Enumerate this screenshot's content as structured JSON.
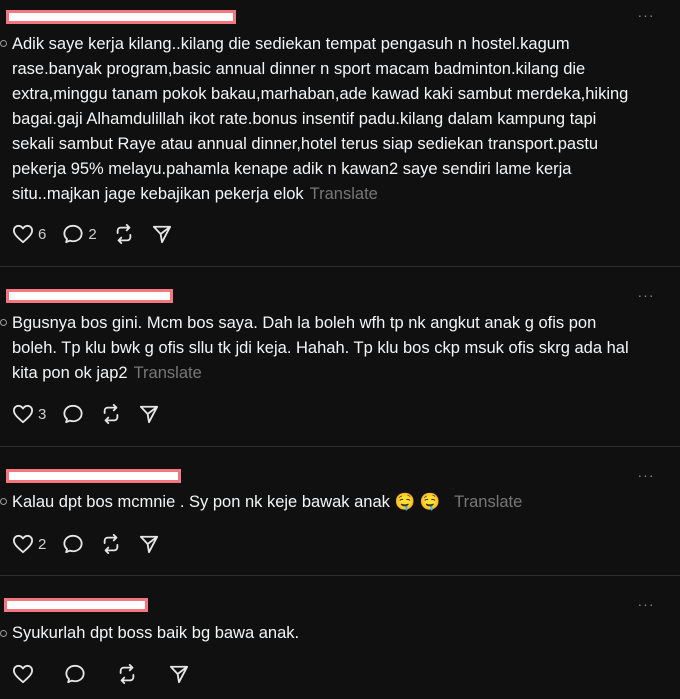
{
  "colors": {
    "background": "#101010",
    "text": "#f3f5f7",
    "muted": "#777777",
    "redaction_border": "#f4777f"
  },
  "icons": {
    "like": "heart-icon",
    "reply": "comment-icon",
    "repost": "repost-icon",
    "share": "send-icon",
    "menu": "more-icon"
  },
  "more_label": "···",
  "translate_label": "Translate",
  "posts": [
    {
      "text": "Adik saye kerja kilang..kilang die sediekan tempat pengasuh n hostel.kagum rase.banyak program,basic annual dinner n sport macam badminton.kilang die extra,minggu tanam pokok bakau,marhaban,ade kawad kaki sambut merdeka,hiking bagai.gaji Alhamdulillah ikot rate.bonus insentif padu.kilang dalam kampung tapi sekali sambut Raye atau annual dinner,hotel terus siap sediekan transport.pastu pekerja 95% melayu.pahamla kenape adik n kawan2 saye sendiri lame kerja situ..majkan jage kebajikan pekerja elok",
      "likes": "6",
      "replies": "2"
    },
    {
      "text": "Bgusnya bos gini. Mcm bos saya. Dah la boleh wfh tp nk angkut anak g ofis pon boleh. Tp klu bwk g ofis sllu tk jdi keja. Hahah. Tp klu bos ckp msuk ofis skrg ada hal kita pon ok jap2",
      "likes": "3",
      "replies": ""
    },
    {
      "text": "Kalau dpt bos mcmnie . Sy pon nk keje bawak anak 🤤 🤤",
      "likes": "2",
      "replies": ""
    },
    {
      "text": "Syukurlah dpt boss baik bg bawa anak.",
      "likes": "",
      "replies": ""
    }
  ]
}
